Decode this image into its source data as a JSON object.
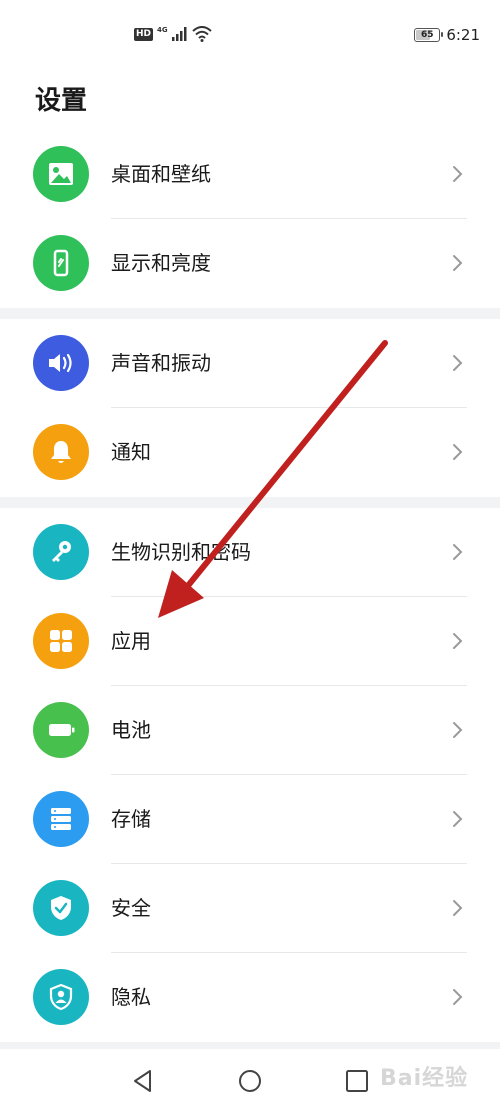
{
  "status_bar": {
    "hd": "HD",
    "network": "4G",
    "battery": "65",
    "battery_level": 0.65,
    "time": "6:21"
  },
  "page": {
    "title": "设置"
  },
  "groups": [
    {
      "items": [
        {
          "label": "桌面和壁纸",
          "icon": "image-icon",
          "color": "#2fc05a"
        },
        {
          "label": "显示和亮度",
          "icon": "phone-brightness-icon",
          "color": "#2fc05a"
        }
      ]
    },
    {
      "items": [
        {
          "label": "声音和振动",
          "icon": "speaker-icon",
          "color": "#3d5ce0"
        },
        {
          "label": "通知",
          "icon": "bell-icon",
          "color": "#f5a00f"
        }
      ]
    },
    {
      "items": [
        {
          "label": "生物识别和密码",
          "icon": "key-icon",
          "color": "#19b6c2"
        },
        {
          "label": "应用",
          "icon": "apps-grid-icon",
          "color": "#f5a00f"
        },
        {
          "label": "电池",
          "icon": "battery-icon",
          "color": "#48c04e"
        },
        {
          "label": "存储",
          "icon": "storage-icon",
          "color": "#2b9cf0"
        },
        {
          "label": "安全",
          "icon": "shield-check-icon",
          "color": "#19b6c2"
        },
        {
          "label": "隐私",
          "icon": "privacy-shield-icon",
          "color": "#19b6c2"
        }
      ]
    }
  ],
  "annotation": {
    "arrow_color": "#c0201e"
  },
  "watermark": "Bai经验"
}
